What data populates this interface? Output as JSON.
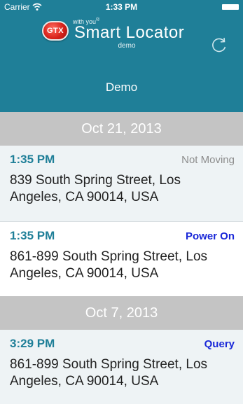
{
  "status_bar": {
    "carrier": "Carrier",
    "time": "1:33 PM"
  },
  "brand": {
    "logo_text": "GTX",
    "tagline": "with you",
    "trademark": "®",
    "title": "Smart Locator",
    "subtitle": "demo"
  },
  "nav": {
    "title": "Demo"
  },
  "colors": {
    "header": "#1f7f98",
    "section": "#c4c4c4",
    "time": "#1f7f98",
    "status_blue": "#1a28d8",
    "status_gray": "#8c8c8c"
  },
  "sections": [
    {
      "date": "Oct 21, 2013",
      "entries": [
        {
          "time": "1:35 PM",
          "status": "Not Moving",
          "address": "839 South Spring Street, Los Angeles, CA 90014, USA"
        },
        {
          "time": "1:35 PM",
          "status": "Power On",
          "address": "861-899 South Spring Street, Los Angeles, CA 90014, USA"
        }
      ]
    },
    {
      "date": "Oct 7, 2013",
      "entries": [
        {
          "time": "3:29 PM",
          "status": "Query",
          "address": "861-899 South Spring Street, Los Angeles, CA 90014, USA"
        }
      ]
    }
  ]
}
